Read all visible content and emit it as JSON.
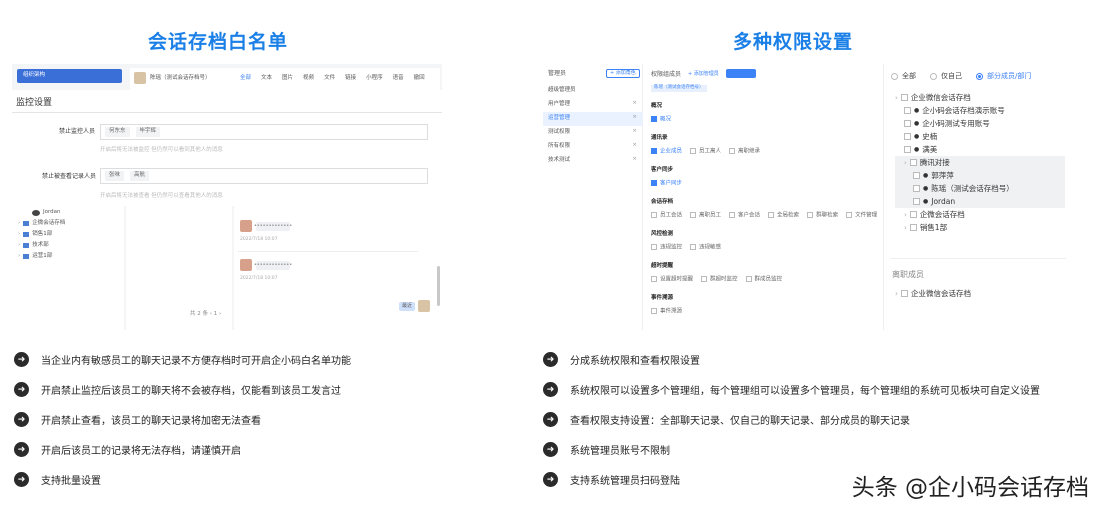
{
  "left_title": "会话存档白名单",
  "right_title": "多种权限设置",
  "left_panel": {
    "sidebar_header": "组织架构",
    "chat_user": "陈瑶（测试会话存档号）",
    "tabs": [
      "全部",
      "文本",
      "图片",
      "视频",
      "文件",
      "链接",
      "小程序",
      "语音",
      "撤回"
    ],
    "page_title": "监控设置",
    "field1_label": "禁止监控人员",
    "field1_tags": [
      "何东东",
      "毕宇辉"
    ],
    "field1_hint": "开启后将无法被监控 但仍然可以看到其他人的消息",
    "field2_label": "禁止被查看记录人员",
    "field2_tags": [
      "张味",
      "高航"
    ],
    "field2_hint": "开启后将无法被查看 但仍然可以查看其他人的消息",
    "tree": [
      "Jordan",
      "企微会话存档",
      "销售1部",
      "技术部",
      "运营1部"
    ],
    "msg_time1": "2022/7/18 10:07",
    "msg_time2": "2022/7/18 10:07",
    "pager": "共 2 条  ‹  1  ›",
    "reply": "最近"
  },
  "right_panel": {
    "admin_header": "管理员",
    "add_admin": "+ 添加角色",
    "admins": [
      "超级管理员",
      "用户管理",
      "运营管理",
      "测试权限",
      "所有权限",
      "技术测试"
    ],
    "group_label": "权限组成员",
    "add_member": "+ 添加管理员",
    "member_tag": "陈瑶（测试会话存档号）",
    "sections": [
      {
        "name": "概况",
        "items": [
          "概况"
        ],
        "on": [
          true
        ]
      },
      {
        "name": "通讯录",
        "items": [
          "企业成员",
          "员工离人",
          "离职继承"
        ],
        "on": [
          true,
          false,
          false
        ]
      },
      {
        "name": "客户同步",
        "items": [
          "客户同步"
        ],
        "on": [
          true
        ]
      },
      {
        "name": "会话存档",
        "items": [
          "员工会话",
          "离职员工",
          "客户会话",
          "全局检索",
          "群聊检索",
          "文件管理"
        ],
        "on": [
          false,
          false,
          false,
          false,
          false,
          false
        ]
      },
      {
        "name": "风控检测",
        "items": [
          "违规监控",
          "违规敏感"
        ],
        "on": [
          false,
          false
        ]
      },
      {
        "name": "超时提醒",
        "items": [
          "设置超时提醒",
          "群超时监控",
          "群成员监控"
        ],
        "on": [
          false,
          false,
          false
        ]
      },
      {
        "name": "事件溯源",
        "items": [
          "事件溯源"
        ],
        "on": [
          false
        ]
      }
    ],
    "radio_options": [
      "全部",
      "仅自己",
      "部分成员/部门"
    ],
    "tree": [
      {
        "label": "企业微信会话存档",
        "level": 0,
        "type": "folder"
      },
      {
        "label": "企小码会话存档演示账号",
        "level": 1,
        "type": "user"
      },
      {
        "label": "企小码测试专用账号",
        "level": 1,
        "type": "user"
      },
      {
        "label": "史楠",
        "level": 1,
        "type": "user"
      },
      {
        "label": "满美",
        "level": 1,
        "type": "user"
      },
      {
        "label": "腾讯对接",
        "level": 1,
        "type": "folder"
      },
      {
        "label": "郭萍萍",
        "level": 2,
        "type": "user"
      },
      {
        "label": "陈瑶（测试会话存档号）",
        "level": 2,
        "type": "user"
      },
      {
        "label": "Jordan",
        "level": 2,
        "type": "user"
      },
      {
        "label": "企微会话存档",
        "level": 1,
        "type": "folder"
      },
      {
        "label": "销售1部",
        "level": 1,
        "type": "folder"
      }
    ],
    "left_members_title": "离职成员",
    "left_members": [
      "企业微信会话存档"
    ]
  },
  "left_bullets": [
    "当企业内有敏感员工的聊天记录不方便存档时可开启企小码白名单功能",
    "开启禁止监控后该员工的聊天将不会被存档，仅能看到该员工发言过",
    "开启禁止查看，该员工的聊天记录将加密无法查看",
    "开启后该员工的记录将无法存档，请谨慎开启",
    "支持批量设置"
  ],
  "right_bullets": [
    "分成系统权限和查看权限设置",
    "系统权限可以设置多个管理组，每个管理组可以设置多个管理员，每个管理组的系统可见板块可自定义设置",
    "查看权限支持设置：全部聊天记录、仅自己的聊天记录、部分成员的聊天记录",
    "系统管理员账号不限制",
    "支持系统管理员扫码登陆"
  ],
  "watermark": "头条 @企小码会话存档",
  "colors": {
    "accent": "#1a7fe6",
    "check": "#3b82f6"
  }
}
